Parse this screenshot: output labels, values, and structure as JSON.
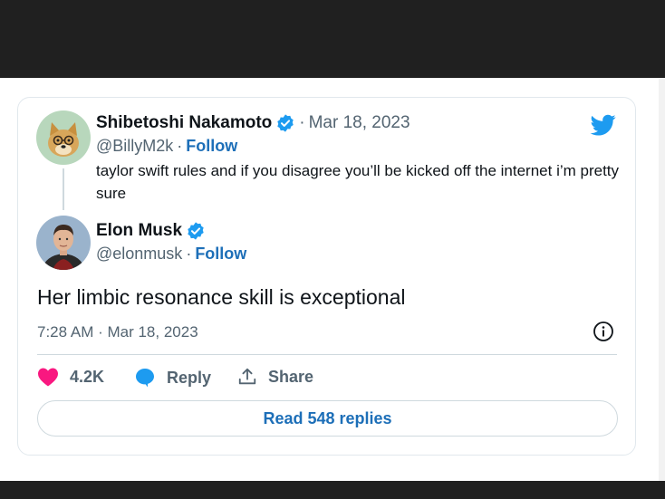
{
  "parent_tweet": {
    "author_name": "Shibetoshi Nakamoto",
    "handle": "@BillyM2k",
    "dot": "·",
    "date": "Mar 18, 2023",
    "follow_label": "Follow",
    "text": "taylor swift rules and if you disagree you’ll be kicked off the internet i’m pretty sure"
  },
  "main_tweet": {
    "author_name": "Elon Musk",
    "handle": "@elonmusk",
    "dot": "·",
    "follow_label": "Follow",
    "text": "Her limbic resonance skill is exceptional",
    "timestamp": "7:28 AM · Mar 18, 2023"
  },
  "actions": {
    "like_count": "4.2K",
    "reply_label": "Reply",
    "share_label": "Share"
  },
  "read_replies_label": "Read 548 replies",
  "colors": {
    "twitter_blue": "#1d9bf0",
    "follow_link": "#1d6fb8",
    "like_pink": "#f91880",
    "muted_text": "#536471",
    "border": "#cfd9de",
    "letterbox": "#202020"
  },
  "icons": [
    "verified-badge-icon",
    "twitter-bird-icon",
    "info-icon",
    "heart-icon",
    "reply-bubble-icon",
    "share-icon"
  ]
}
